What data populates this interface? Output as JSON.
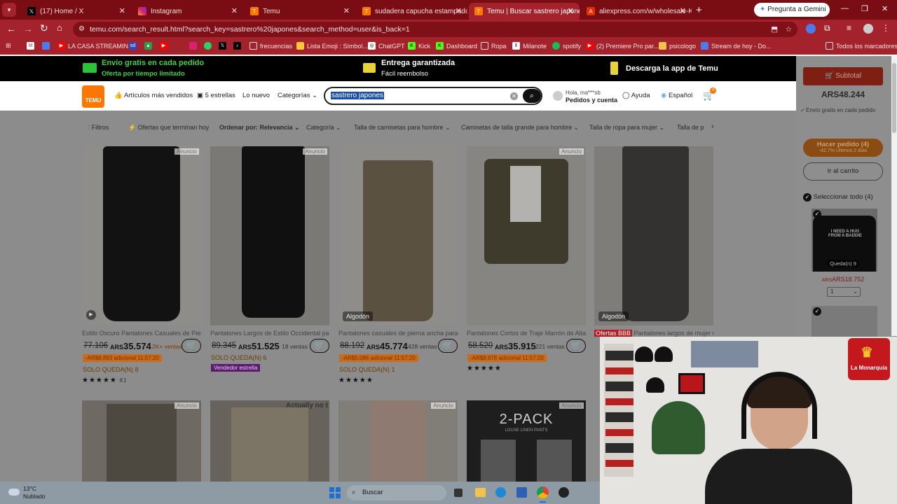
{
  "tabs": [
    {
      "label": "(17) Home / X",
      "icon": "x-icon"
    },
    {
      "label": "Instagram",
      "icon": "instagram-icon"
    },
    {
      "label": "Temu",
      "icon": "temu-icon"
    },
    {
      "label": "sudadera capucha estampado l",
      "icon": "temu-icon"
    },
    {
      "label": "Temu | Buscar sastrero japones",
      "icon": "temu-icon"
    },
    {
      "label": "aliexpress.com/w/wholesale-Ki",
      "icon": "aliexpress-icon"
    }
  ],
  "browser": {
    "url": "temu.com/search_result.html?search_key=sastrero%20japones&search_method=user&is_back=1",
    "gemini": "Pregunta a Gemini"
  },
  "bookmarks": [
    {
      "label": "",
      "icon": "gmail-icon"
    },
    {
      "label": "",
      "icon": "docs-icon"
    },
    {
      "label": "LA CASA STREAMIN...",
      "icon": "youtube-icon"
    },
    {
      "label": "",
      "icon": "sd-icon"
    },
    {
      "label": "",
      "icon": "drive-icon"
    },
    {
      "label": "",
      "icon": "youtube-icon"
    },
    {
      "label": "",
      "icon": "instagram-icon"
    },
    {
      "label": "",
      "icon": "whatsapp-icon"
    },
    {
      "label": "",
      "icon": "x-icon"
    },
    {
      "label": "",
      "icon": "tiktok-icon"
    },
    {
      "label": "frecuencias",
      "icon": "folder-icon"
    },
    {
      "label": "Lista Emoji : Símbol...",
      "icon": "emoji-icon"
    },
    {
      "label": "ChatGPT",
      "icon": "chatgpt-icon"
    },
    {
      "label": "Kick",
      "icon": "kick-icon"
    },
    {
      "label": "Dashboard",
      "icon": "kick-icon"
    },
    {
      "label": "Ropa",
      "icon": "folder-icon"
    },
    {
      "label": "Milanote",
      "icon": "milanote-icon"
    },
    {
      "label": "spotify",
      "icon": "spotify-icon"
    },
    {
      "label": "(2) Premiere Pro par...",
      "icon": "youtube-icon"
    },
    {
      "label": "psicologo",
      "icon": "folder-icon"
    },
    {
      "label": "Stream de hoy - Do...",
      "icon": "docs-icon"
    },
    {
      "label": "Todos los marcadores",
      "icon": "folder-icon"
    }
  ],
  "promo": {
    "shipping_title": "Envío gratis en cada pedido",
    "shipping_sub": "Oferta por tiempo limitado",
    "delivery_title": "Entrega garantizada",
    "delivery_sub": "Fácil reembolso",
    "app": "Descarga la app de Temu"
  },
  "header": {
    "logo": "TEMU",
    "nav": [
      "Artículos más vendidos",
      "5 estrellas",
      "Lo nuevo",
      "Categorías"
    ],
    "search_value": "sastrero japones",
    "account_hi": "Hola, ma***sb",
    "account_label": "Pedidos y cuenta",
    "help": "Ayuda",
    "lang": "Español",
    "cart_count": "4"
  },
  "filters": [
    "Filtros",
    "Ofertas que terminan hoy",
    "Ordenar por: Relevancia",
    "Categoría",
    "Talla de camisetas para hombre",
    "Camisetas de talla grande para hombre",
    "Talla de ropa para mujer",
    "Talla de p"
  ],
  "products": [
    {
      "title": "Estilo Oscuro Pantalones Casuales de Piern...",
      "old": "77.106",
      "new": "35.574",
      "sold": "2K+ ventas",
      "extra": "-AR$8.893 adicional",
      "timer": "11:57:20",
      "left": "SOLO QUEDA(N) 8",
      "stars": "★★★★★",
      "reviews": "81",
      "ad": "Anuncio",
      "fabric": "",
      "bg": "#c6c3be",
      "fig": "#1c1c1c"
    },
    {
      "title": "Pantalones Largos de Estilo Occidental par...",
      "old": "89.345",
      "new": "51.525",
      "sold": "18 ventas",
      "extra": "",
      "timer": "",
      "left": "SOLO QUEDA(N) 6",
      "stars": "",
      "reviews": "",
      "ad": "Anuncio",
      "fabric": "",
      "bg": "#b4b1ac",
      "fig": "#181818",
      "star_seller": "Vendedor estrella"
    },
    {
      "title": "Pantalones casuales de pierna ancha para ...",
      "old": "88.192",
      "new": "45.774",
      "sold": "428 ventas",
      "extra": "-AR$5.086 adicional",
      "timer": "11:57:20",
      "left": "SOLO QUEDA(N) 1",
      "stars": "★★★★★",
      "reviews": "",
      "ad": "",
      "fabric": "Algodón",
      "bg": "#e8e6e2",
      "fig": "#8c7d62"
    },
    {
      "title": "Pantalones Cortos de Traje Marrón de Alta ...",
      "old": "58.520",
      "new": "35.915",
      "sold": "221 ventas",
      "extra": "-AR$8.978 adicional",
      "timer": "11:57:20",
      "left": "",
      "stars": "★★★★★",
      "reviews": "",
      "ad": "Anuncio",
      "fabric": "",
      "bg": "#dedbd5",
      "fig": "#5f5843"
    },
    {
      "title": "Pantalones largos de mujer ult...",
      "old": "",
      "new": "",
      "sold": "",
      "extra": "",
      "timer": "",
      "left": "",
      "stars": "",
      "reviews": "",
      "ad": "",
      "fabric": "Algodón",
      "bg": "#c0bdb8",
      "fig": "#4f4d49",
      "tag": "Ofertas BBB"
    }
  ],
  "row2": [
    {
      "ad": "Anuncio",
      "bg": "#b6b0a6"
    },
    {
      "ad": "Actually no t",
      "bg": "#a8a39a"
    },
    {
      "ad": "Anuncio",
      "bg": "#cfcbc4"
    },
    {
      "ad": "Anuncio",
      "bg": "#2c2c2c",
      "text": "2-PACK",
      "sub": "LOUSE LINEN PANTS"
    }
  ],
  "cart_sidebar": {
    "subtotal_btn": "Subtotal",
    "total": "ARS48.244",
    "free_ship": "Envío gratis en cada pedido",
    "order_btn": "Hacer pedido (4)",
    "order_sub": "-42.7% Últimos 2 días",
    "go_cart": "Ir al carrito",
    "select_all": "Seleccionar todo (4)",
    "item_shirt": "I NEED A HUG FROM A BADDIE",
    "item_left": "Queda(n) 9",
    "item_price": "ARS18.752",
    "item_qty": "1"
  },
  "taskbar": {
    "temp": "13°C",
    "weather": "Nublado",
    "search": "Buscar"
  },
  "webcam": {
    "logo": "La Monarquía"
  }
}
